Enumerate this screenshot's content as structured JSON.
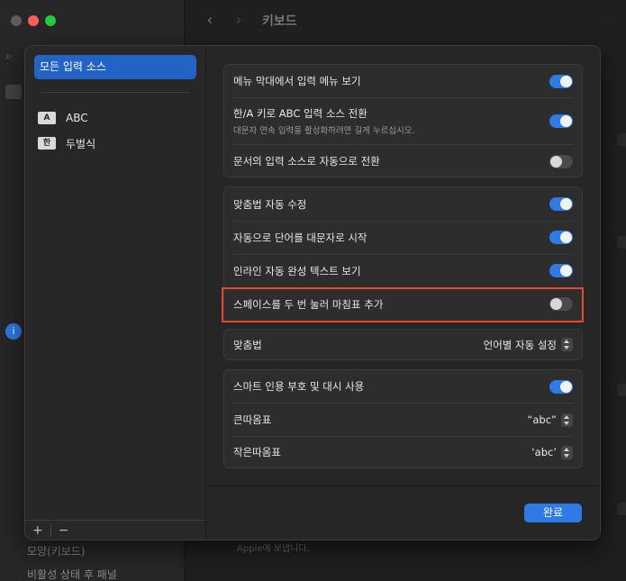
{
  "background": {
    "toolbar_title": "키보드",
    "sidebar_bottom_items": [
      "모양(키보드)",
      "비활성 상태 후 패널"
    ],
    "main_footer_text": "Apple에 보냅니다."
  },
  "sheet": {
    "sources": {
      "selected": "모든 입력 소스",
      "items": [
        {
          "badge": "A",
          "label": "ABC"
        },
        {
          "badge": "한",
          "label": "두벌식"
        }
      ],
      "add": "+",
      "remove": "−"
    },
    "group1": [
      {
        "label": "메뉴 막대에서 입력 메뉴 보기",
        "toggle": "on"
      },
      {
        "label": "한/A 키로 ABC 입력 소스 전환",
        "sub": "대문자 연속 입력을 활성화하려면 길게 누르십시오.",
        "toggle": "on"
      },
      {
        "label": "문서의 입력 소스로 자동으로 전환",
        "toggle": "off"
      }
    ],
    "group2": [
      {
        "label": "맞춤법 자동 수정",
        "toggle": "on"
      },
      {
        "label": "자동으로 단어를 대문자로 시작",
        "toggle": "on"
      },
      {
        "label": "인라인 자동 완성 텍스트 보기",
        "toggle": "on"
      },
      {
        "label": "스페이스를 두 번 눌러 마침표 추가",
        "toggle": "off"
      }
    ],
    "spelling": {
      "label": "맞춤법",
      "value": "언어별 자동 설정"
    },
    "group4": {
      "smart_quotes": {
        "label": "스마트 인용 부호 및 대시 사용",
        "toggle": "on"
      },
      "double_quotes": {
        "label": "큰따옴표",
        "value": "“abc”"
      },
      "single_quotes": {
        "label": "작은따옴표",
        "value": "‘abc’"
      }
    },
    "done_label": "완료"
  },
  "colors": {
    "accent": "#2f7be5",
    "highlight": "#e8472b"
  }
}
